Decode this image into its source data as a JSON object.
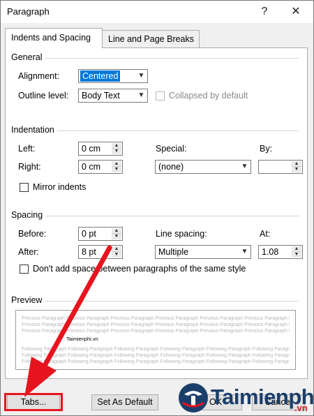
{
  "window": {
    "title": "Paragraph",
    "help_glyph": "?",
    "close_glyph": "✕"
  },
  "tabs": [
    {
      "label": "Indents and Spacing",
      "active": true
    },
    {
      "label": "Line and Page Breaks",
      "active": false
    }
  ],
  "general": {
    "title": "General",
    "alignment_label": "Alignment:",
    "alignment_value": "Centered",
    "outline_label": "Outline level:",
    "outline_value": "Body Text",
    "collapsed_label": "Collapsed by default"
  },
  "indentation": {
    "title": "Indentation",
    "left_label": "Left:",
    "left_value": "0 cm",
    "right_label": "Right:",
    "right_value": "0 cm",
    "special_label": "Special:",
    "special_value": "(none)",
    "by_label": "By:",
    "by_value": "",
    "mirror_label": "Mirror indents"
  },
  "spacing": {
    "title": "Spacing",
    "before_label": "Before:",
    "before_value": "0 pt",
    "after_label": "After:",
    "after_value": "8 pt",
    "line_spacing_label": "Line spacing:",
    "line_spacing_value": "Multiple",
    "at_label": "At:",
    "at_value": "1.08",
    "dont_add_label": "Don't add space between paragraphs of the same style"
  },
  "preview": {
    "title": "Preview",
    "previous_text": "Previous Paragraph Previous Paragraph Previous Paragraph Previous Paragraph Previous Paragraph Previous Paragraph Previous Paragraph",
    "sample_text": "Taimienphi.vn",
    "following_text": "Following Paragraph Following Paragraph Following Paragraph Following Paragraph Following Paragraph Following Paragraph"
  },
  "buttons": {
    "tabs": "Tabs...",
    "set_default": "Set As Default",
    "ok": "OK",
    "cancel": "Cancel"
  },
  "watermark": {
    "brand": "Taimienphi",
    "suffix": ".vn"
  },
  "colors": {
    "highlight": "#e6141e",
    "selection": "#0078d7",
    "brand": "#1b3f6b"
  }
}
